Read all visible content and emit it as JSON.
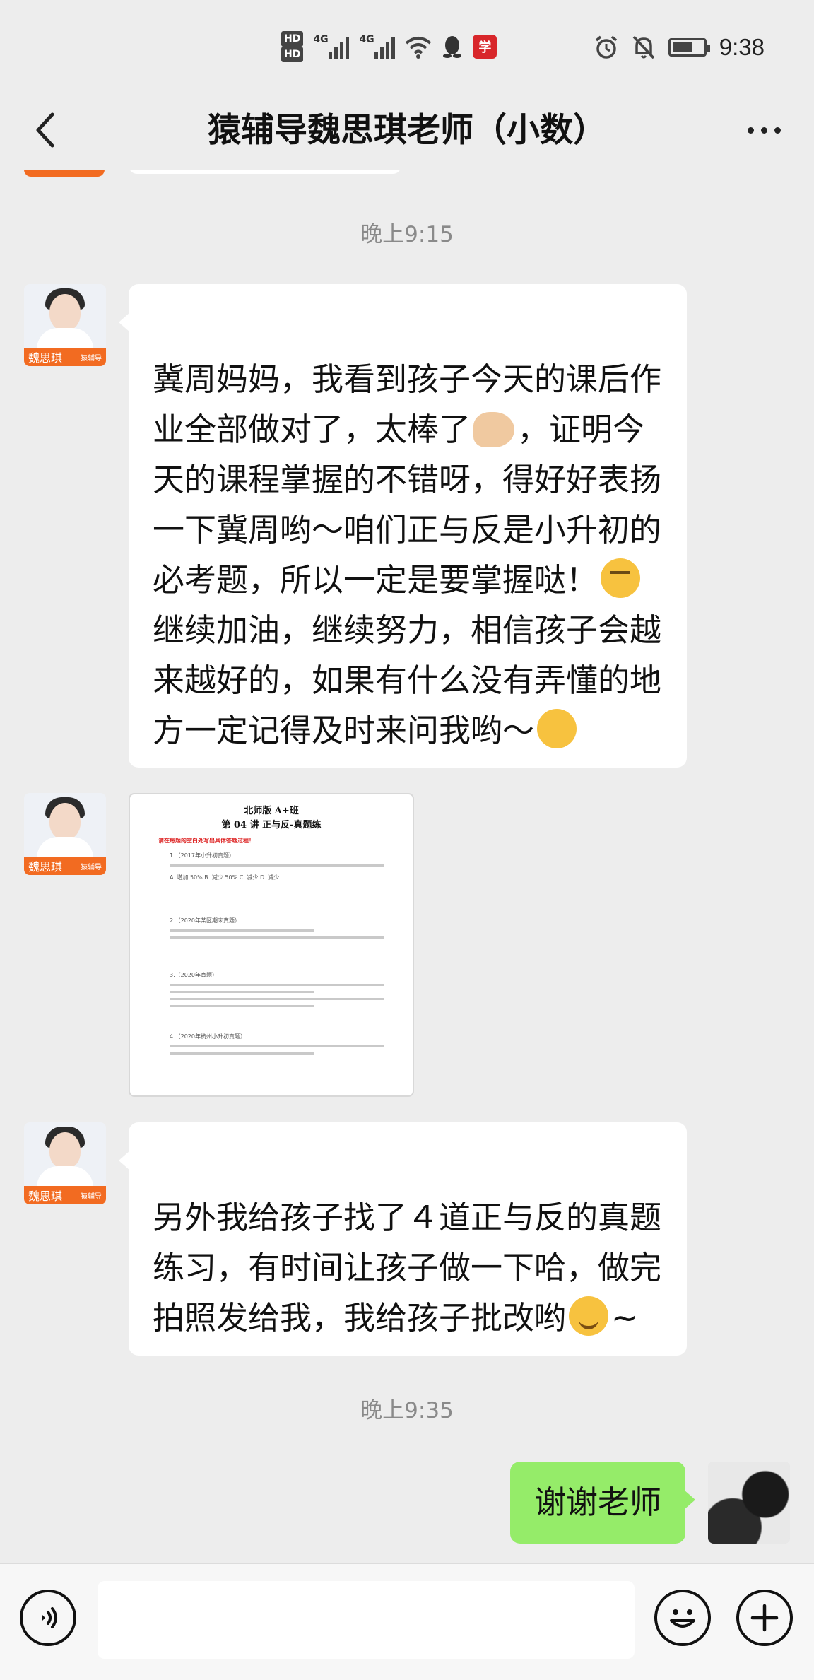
{
  "status_bar": {
    "hd1": "HD",
    "hd2": "HD",
    "net1": "4G",
    "net2": "4G",
    "app_badge": "学",
    "time": "9:38",
    "battery_level": 0.65
  },
  "header": {
    "title": "猿辅导魏思琪老师（小数）"
  },
  "messages": {
    "timestamp1": "晚上9:15",
    "teacher_name": "魏思琪",
    "teacher_badge": "猿辅导",
    "msg1_part1": "冀周妈妈，我看到孩子今天的课后作业全部做对了，太棒了",
    "msg1_part2": "，证明今天的课程掌握的不错呀，得好好表扬一下冀周哟～咱们正与反是小升初的必考题，所以一定是要掌握哒！",
    "msg1_part3": "\n继续加油，继续努力，相信孩子会越来越好的，如果有什么没有弄懂的地方一定记得及时来问我哟～",
    "doc": {
      "title_line1": "北师版 A+班",
      "title_line2": "第 04 讲 正与反-真题练",
      "red_note": "请在每题的空白处写出具体答题过程！",
      "q1": "1.（2017年小升初真题）",
      "q1_options": "A. 增加 50%   B. 减少 50%   C. 减少   D. 减少",
      "q2": "2.（2020年某区期末真题）",
      "q3": "3.（2020年真题）",
      "q4": "4.（2020年杭州小升初真题）"
    },
    "msg2": "另外我给孩子找了４道正与反的真题练习，有时间让孩子做一下哈，做完拍照发给我，我给孩子批改哟",
    "msg2_tail": "~",
    "timestamp2": "晚上9:35",
    "my_reply": "谢谢老师"
  },
  "input_bar": {
    "placeholder": ""
  },
  "icons": {
    "back": "chevron-left-icon",
    "more": "more-dots-icon",
    "voice": "voice-icon",
    "emoji": "emoji-icon",
    "plus": "plus-icon"
  }
}
